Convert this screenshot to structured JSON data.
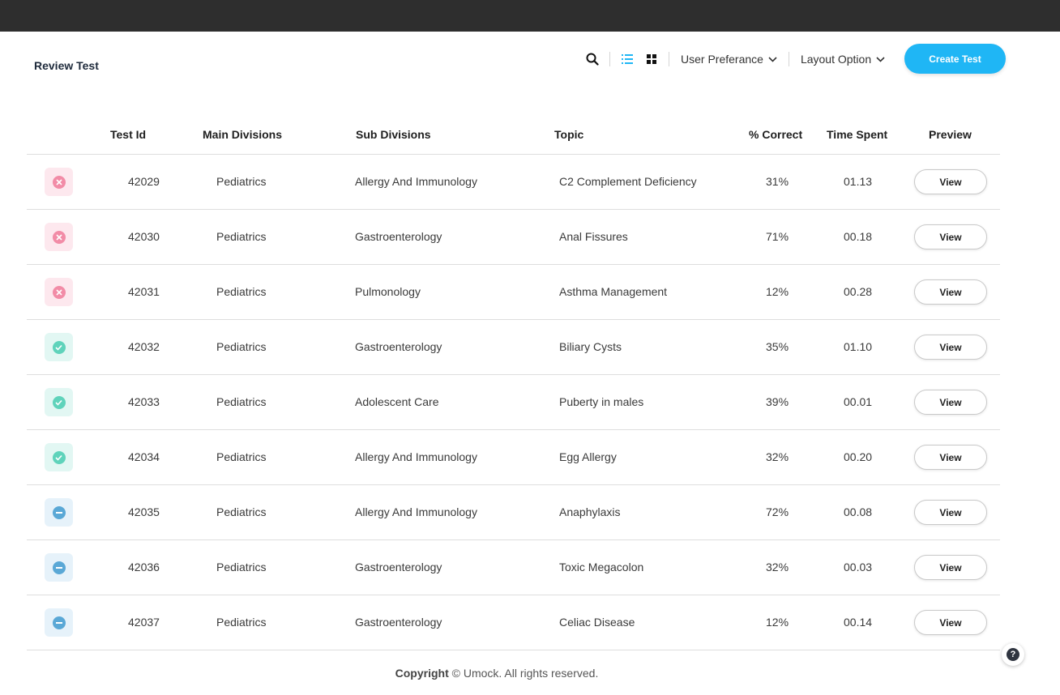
{
  "header": {
    "title": "Review Test"
  },
  "toolbar": {
    "user_preference_label": "User Preferance",
    "layout_option_label": "Layout Option",
    "create_label": "Create Test",
    "accent_color": "#1fb6f5"
  },
  "table": {
    "columns": {
      "test_id": "Test Id",
      "main": "Main Divisions",
      "sub": "Sub Divisions",
      "topic": "Topic",
      "correct": "% Correct",
      "time": "Time Spent",
      "preview": "Preview"
    },
    "view_label": "View",
    "rows": [
      {
        "status": "fail",
        "id": "42029",
        "main": "Pediatrics",
        "sub": "Allergy And Immunology",
        "topic": "C2 Complement Deficiency",
        "correct": "31%",
        "time": "01.13"
      },
      {
        "status": "fail",
        "id": "42030",
        "main": "Pediatrics",
        "sub": "Gastroenterology",
        "topic": "Anal Fissures",
        "correct": "71%",
        "time": "00.18"
      },
      {
        "status": "fail",
        "id": "42031",
        "main": "Pediatrics",
        "sub": "Pulmonology",
        "topic": "Asthma Management",
        "correct": "12%",
        "time": "00.28"
      },
      {
        "status": "pass",
        "id": "42032",
        "main": "Pediatrics",
        "sub": "Gastroenterology",
        "topic": "Biliary Cysts",
        "correct": "35%",
        "time": "01.10"
      },
      {
        "status": "pass",
        "id": "42033",
        "main": "Pediatrics",
        "sub": "Adolescent Care",
        "topic": "Puberty in males",
        "correct": "39%",
        "time": "00.01"
      },
      {
        "status": "pass",
        "id": "42034",
        "main": "Pediatrics",
        "sub": "Allergy And Immunology",
        "topic": "Egg Allergy",
        "correct": "32%",
        "time": "00.20"
      },
      {
        "status": "skip",
        "id": "42035",
        "main": "Pediatrics",
        "sub": "Allergy And Immunology",
        "topic": "Anaphylaxis",
        "correct": "72%",
        "time": "00.08"
      },
      {
        "status": "skip",
        "id": "42036",
        "main": "Pediatrics",
        "sub": "Gastroenterology",
        "topic": "Toxic Megacolon",
        "correct": "32%",
        "time": "00.03"
      },
      {
        "status": "skip",
        "id": "42037",
        "main": "Pediatrics",
        "sub": "Gastroenterology",
        "topic": "Celiac Disease",
        "correct": "12%",
        "time": "00.14"
      }
    ]
  },
  "footer": {
    "copyright_bold": "Copyright",
    "copyright_rest": "© Umock. All rights reserved."
  },
  "help": {
    "label": "?"
  },
  "icons": [
    "search-icon",
    "list-view-icon",
    "grid-view-icon",
    "chevron-down-icon",
    "close-icon",
    "check-icon",
    "minus-icon",
    "help-icon"
  ]
}
